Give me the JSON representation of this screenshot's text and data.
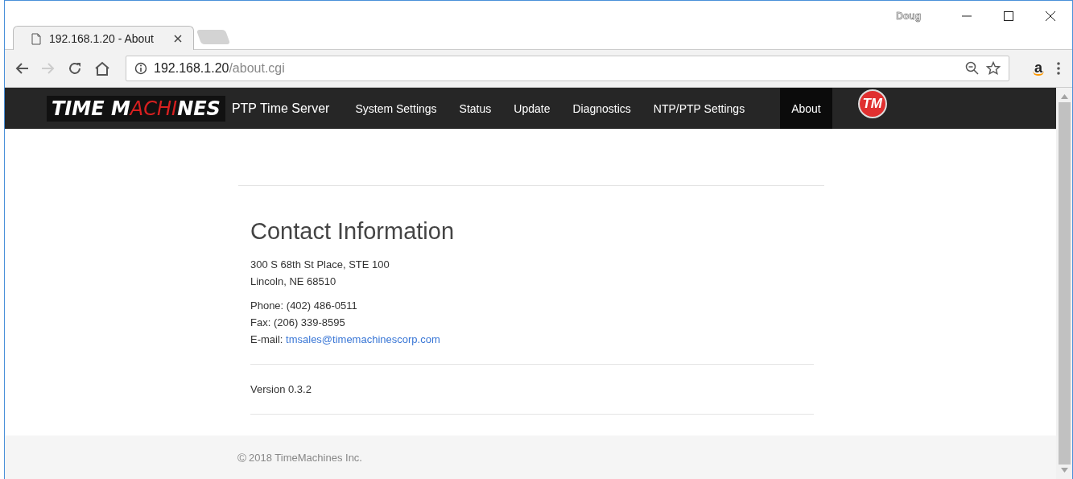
{
  "browser": {
    "profile": "Doug",
    "tabs": [
      {
        "title": "192.168.1.20 - About",
        "selected": true
      }
    ],
    "url_host": "192.168.1.20",
    "url_path": "/about.cgi",
    "extension_badge": "a"
  },
  "navbar": {
    "logo": [
      {
        "text": "TIME M",
        "highlight": false
      },
      {
        "text": "ACHI",
        "highlight": true
      },
      {
        "text": "NES",
        "highlight": false
      }
    ],
    "product": "PTP Time Server",
    "items": [
      {
        "label": "System Settings",
        "selected": false
      },
      {
        "label": "Status",
        "selected": false
      },
      {
        "label": "Update",
        "selected": false
      },
      {
        "label": "Diagnostics",
        "selected": false
      },
      {
        "label": "NTP/PTP Settings",
        "selected": false
      },
      {
        "label": "About",
        "selected": true
      }
    ],
    "badge": "TM"
  },
  "contact": {
    "heading": "Contact Information",
    "address": [
      "300 S 68th St Place, STE 100",
      "Lincoln, NE 68510"
    ],
    "phone": "Phone: (402) 486-0511",
    "fax": "Fax: (206) 339-8595",
    "email_label": "E-mail:",
    "email": "tmsales@timemachinescorp.com"
  },
  "version": "Version 0.3.2",
  "footer": {
    "symbol": "©",
    "text": "2018 TimeMachines Inc."
  }
}
